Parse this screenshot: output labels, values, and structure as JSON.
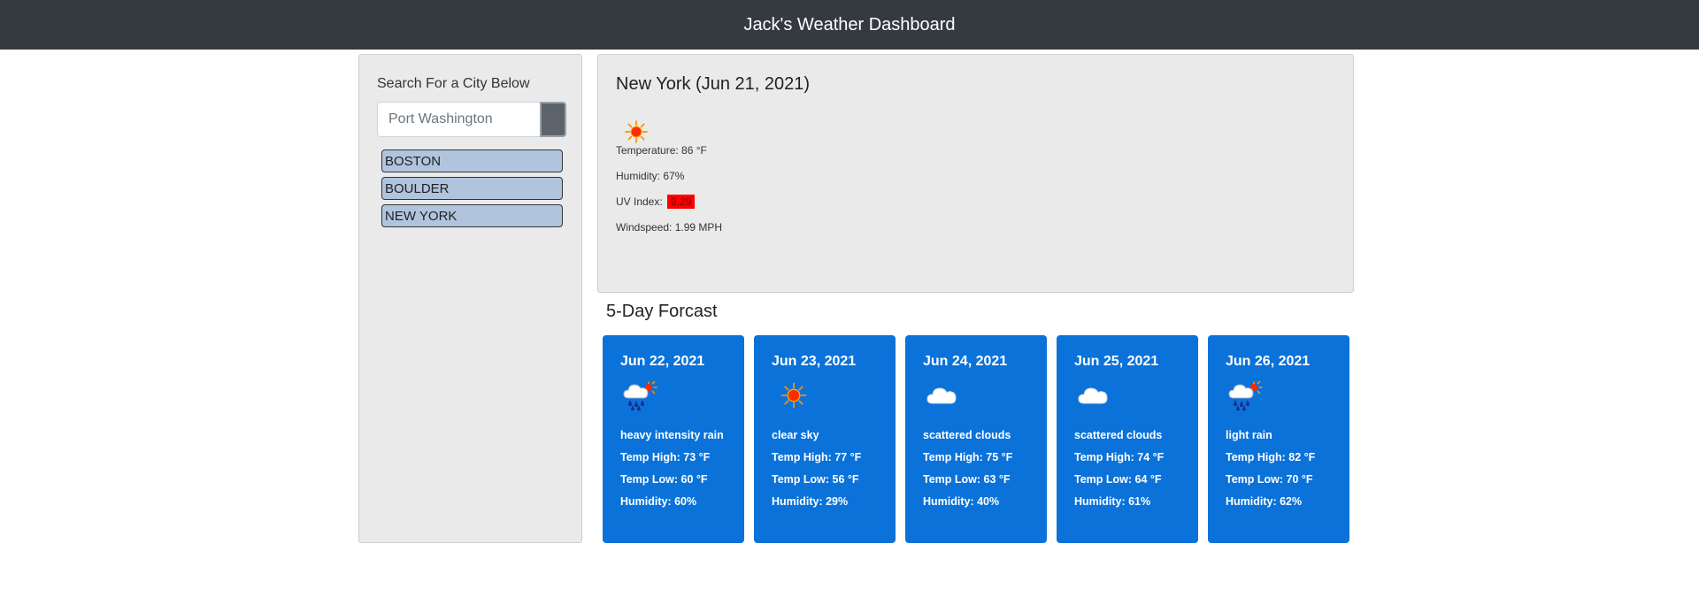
{
  "header": {
    "title": "Jack's Weather Dashboard"
  },
  "sidebar": {
    "search_label": "Search For a City Below",
    "search_placeholder": "Port Washington",
    "search_value": "",
    "history": [
      {
        "label": "BOSTON"
      },
      {
        "label": "BOULDER"
      },
      {
        "label": "NEW YORK"
      }
    ]
  },
  "current": {
    "city_date": "New York (Jun 21, 2021)",
    "icon": "sun-icon",
    "temperature": "Temperature: 86 °F",
    "humidity": "Humidity: 67%",
    "uv_label": "UV Index:",
    "uv_value": "9.29",
    "uv_color": "#ff0000",
    "windspeed": "Windspeed: 1.99 MPH"
  },
  "forecast": {
    "title": "5-Day Forcast",
    "card_color": "#0b72d9",
    "days": [
      {
        "date": "Jun 22, 2021",
        "icon": "rain-icon",
        "desc": "heavy intensity rain",
        "high": "Temp High: 73 °F",
        "low": "Temp Low: 60 °F",
        "humidity": "Humidity: 60%"
      },
      {
        "date": "Jun 23, 2021",
        "icon": "sun-icon",
        "desc": "clear sky",
        "high": "Temp High: 77 °F",
        "low": "Temp Low: 56 °F",
        "humidity": "Humidity: 29%"
      },
      {
        "date": "Jun 24, 2021",
        "icon": "cloud-icon",
        "desc": "scattered clouds",
        "high": "Temp High: 75 °F",
        "low": "Temp Low: 63 °F",
        "humidity": "Humidity: 40%"
      },
      {
        "date": "Jun 25, 2021",
        "icon": "cloud-icon",
        "desc": "scattered clouds",
        "high": "Temp High: 74 °F",
        "low": "Temp Low: 64 °F",
        "humidity": "Humidity: 61%"
      },
      {
        "date": "Jun 26, 2021",
        "icon": "rain-icon",
        "desc": "light rain",
        "high": "Temp High: 82 °F",
        "low": "Temp Low: 70 °F",
        "humidity": "Humidity: 62%"
      }
    ]
  }
}
